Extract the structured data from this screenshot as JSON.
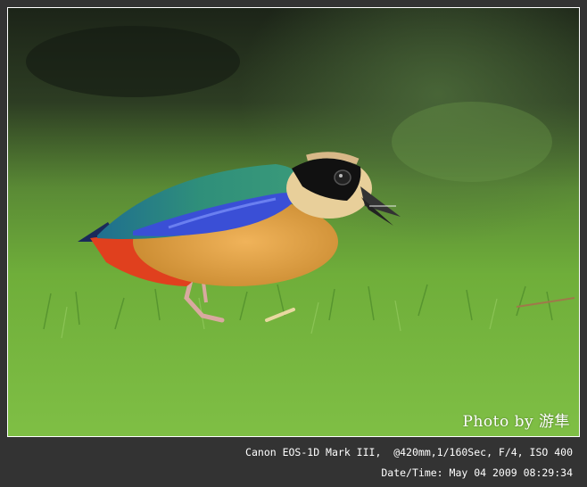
{
  "photo": {
    "subject": "bird-on-grass",
    "colors": {
      "background_top": "#1f2a1a",
      "grass": "#6fae3a",
      "bird_wing": "#2f8f7a",
      "bird_blue": "#3a4fd6",
      "bird_belly": "#e0a048",
      "bird_red": "#e0401e",
      "bird_head": "#111111"
    }
  },
  "credit": "Photo by 游隼",
  "exif": {
    "line1": "Canon EOS-1D Mark III,  @420mm,1/160Sec, F/4, ISO 400",
    "line2": "Date/Time: May 04 2009 08:29:34"
  }
}
